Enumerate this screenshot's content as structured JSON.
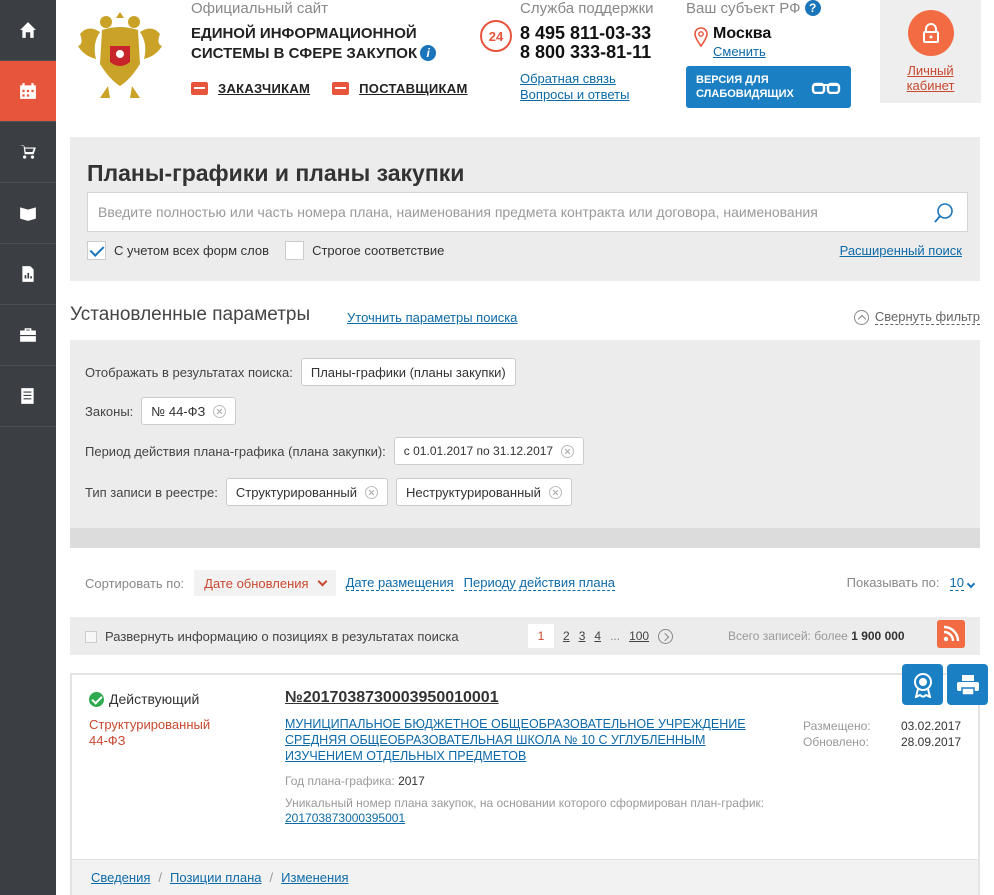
{
  "sidebar": {
    "items": [
      {
        "icon": "home-icon"
      },
      {
        "icon": "calendar-icon",
        "active": true
      },
      {
        "icon": "cart-icon"
      },
      {
        "icon": "book-icon"
      },
      {
        "icon": "report-icon"
      },
      {
        "icon": "briefcase-icon"
      },
      {
        "icon": "document-icon"
      }
    ]
  },
  "header": {
    "site_label": "Официальный сайт",
    "site_title_line1": "ЕДИНОЙ ИНФОРМАЦИОННОЙ",
    "site_title_line2": "СИСТЕМЫ В СФЕРЕ ЗАКУПОК",
    "customers_link": "ЗАКАЗЧИКАМ",
    "suppliers_link": "ПОСТАВЩИКАМ",
    "support_label": "Служба поддержки",
    "support_badge": "24",
    "phone1": "8 495 811-03-33",
    "phone2": "8 800 333-81-11",
    "feedback_link": "Обратная связь",
    "faq_link": "Вопросы и ответы",
    "region_label": "Ваш субъект РФ",
    "region_help": "?",
    "region_city": "Москва",
    "region_change": "Сменить",
    "vision_line1": "ВЕРСИЯ ДЛЯ",
    "vision_line2": "СЛАБОВИДЯЩИХ",
    "cabinet_line1": "Личный",
    "cabinet_line2": "кабинет"
  },
  "search": {
    "title": "Планы-графики и планы закупки",
    "placeholder": "Введите полностью или часть номера плана, наименования предмета контракта или договора, наименования",
    "opt_word_forms": "С учетом всех форм слов",
    "opt_word_forms_checked": true,
    "opt_strict": "Строгое соответствие",
    "opt_strict_checked": false,
    "advanced_link": "Расширенный поиск"
  },
  "params": {
    "title": "Установленные параметры",
    "refine_link": "Уточнить параметры поиска",
    "collapse_link": "Свернуть фильтр",
    "display_label": "Отображать в результатах поиска:",
    "display_value": "Планы-графики (планы закупки)",
    "laws_label": "Законы:",
    "laws_value": "№ 44-ФЗ",
    "period_label": "Период действия плана-графика (плана закупки):",
    "period_value": "с 01.01.2017 по 31.12.2017",
    "type_label": "Тип записи в реестре:",
    "type_value1": "Структурированный",
    "type_value2": "Неструктурированный"
  },
  "sorting": {
    "label": "Сортировать по:",
    "active": "Дате обновления",
    "option2": "Дате размещения",
    "option3": "Периоду действия плана",
    "show_label": "Показывать по:",
    "show_value": "10"
  },
  "results_bar": {
    "expand_label": "Развернуть информацию о позициях в результатах поиска",
    "pages": [
      "1",
      "2",
      "3",
      "4"
    ],
    "ellipsis": "...",
    "last_page": "100",
    "total_label": "Всего записей: более",
    "total_value": "1 900 000"
  },
  "result": {
    "status": "Действующий",
    "kind": "Структурированный",
    "law": "44-ФЗ",
    "number": "№201703873000395001000​1",
    "org": "МУНИЦИПАЛЬНОЕ БЮДЖЕТНОЕ ОБЩЕОБРАЗОВАТЕЛЬНОЕ УЧРЕЖДЕНИЕ СРЕДНЯЯ ОБЩЕОБРАЗОВАТЕЛЬНАЯ ШКОЛА № 10 С УГЛУБЛЕННЫМ ИЗУЧЕНИЕМ ОТДЕЛЬНЫХ ПРЕДМЕТОВ",
    "year_label": "Год плана-графика:",
    "year_value": "2017",
    "unique_label": "Уникальный номер плана закупок, на основании которого сформирован план-график:",
    "unique_value": "201703873000395001",
    "posted_label": "Размещено:",
    "posted_value": "03.02.2017",
    "updated_label": "Обновлено:",
    "updated_value": "28.09.2017",
    "footer_info": "Сведения",
    "footer_positions": "Позиции плана",
    "footer_changes": "Изменения",
    "footer_sep": "/"
  }
}
